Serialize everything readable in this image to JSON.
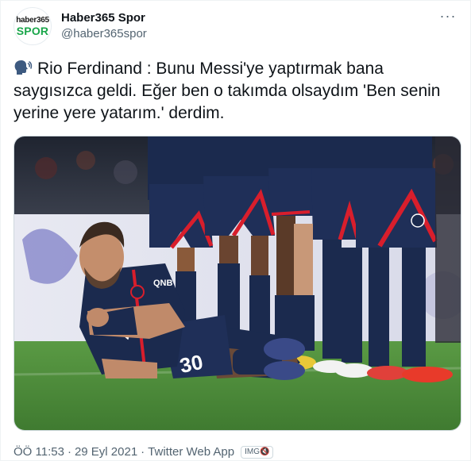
{
  "author": {
    "avatar_top": "haber365",
    "avatar_bottom": "SPOR",
    "display_name": "Haber365 Spor",
    "handle": "@haber365spor"
  },
  "more_label": "···",
  "tweet": {
    "text": "Rio Ferdinand : Bunu Messi'ye yaptırmak bana saygısızca geldi. Eğer ben o takımda olsaydım 'Ben senin yerine yere yatarım.' derdim.",
    "emoji_icon": "speaking-head-icon"
  },
  "media": {
    "type": "photo",
    "jersey_sponsor": "QNB",
    "jersey_number": "30"
  },
  "footer": {
    "time": "ÖÖ 11:53",
    "separator": "·",
    "date": "29 Eyl 2021",
    "source": "Twitter Web App",
    "badge": "IMG🔇"
  },
  "colors": {
    "brand_green": "#1aa64a",
    "text_primary": "#0f1419",
    "text_secondary": "#536471",
    "psg_navy": "#1b2a4e",
    "psg_red": "#d81e2c",
    "pitch_green": "#4e8c3a"
  }
}
